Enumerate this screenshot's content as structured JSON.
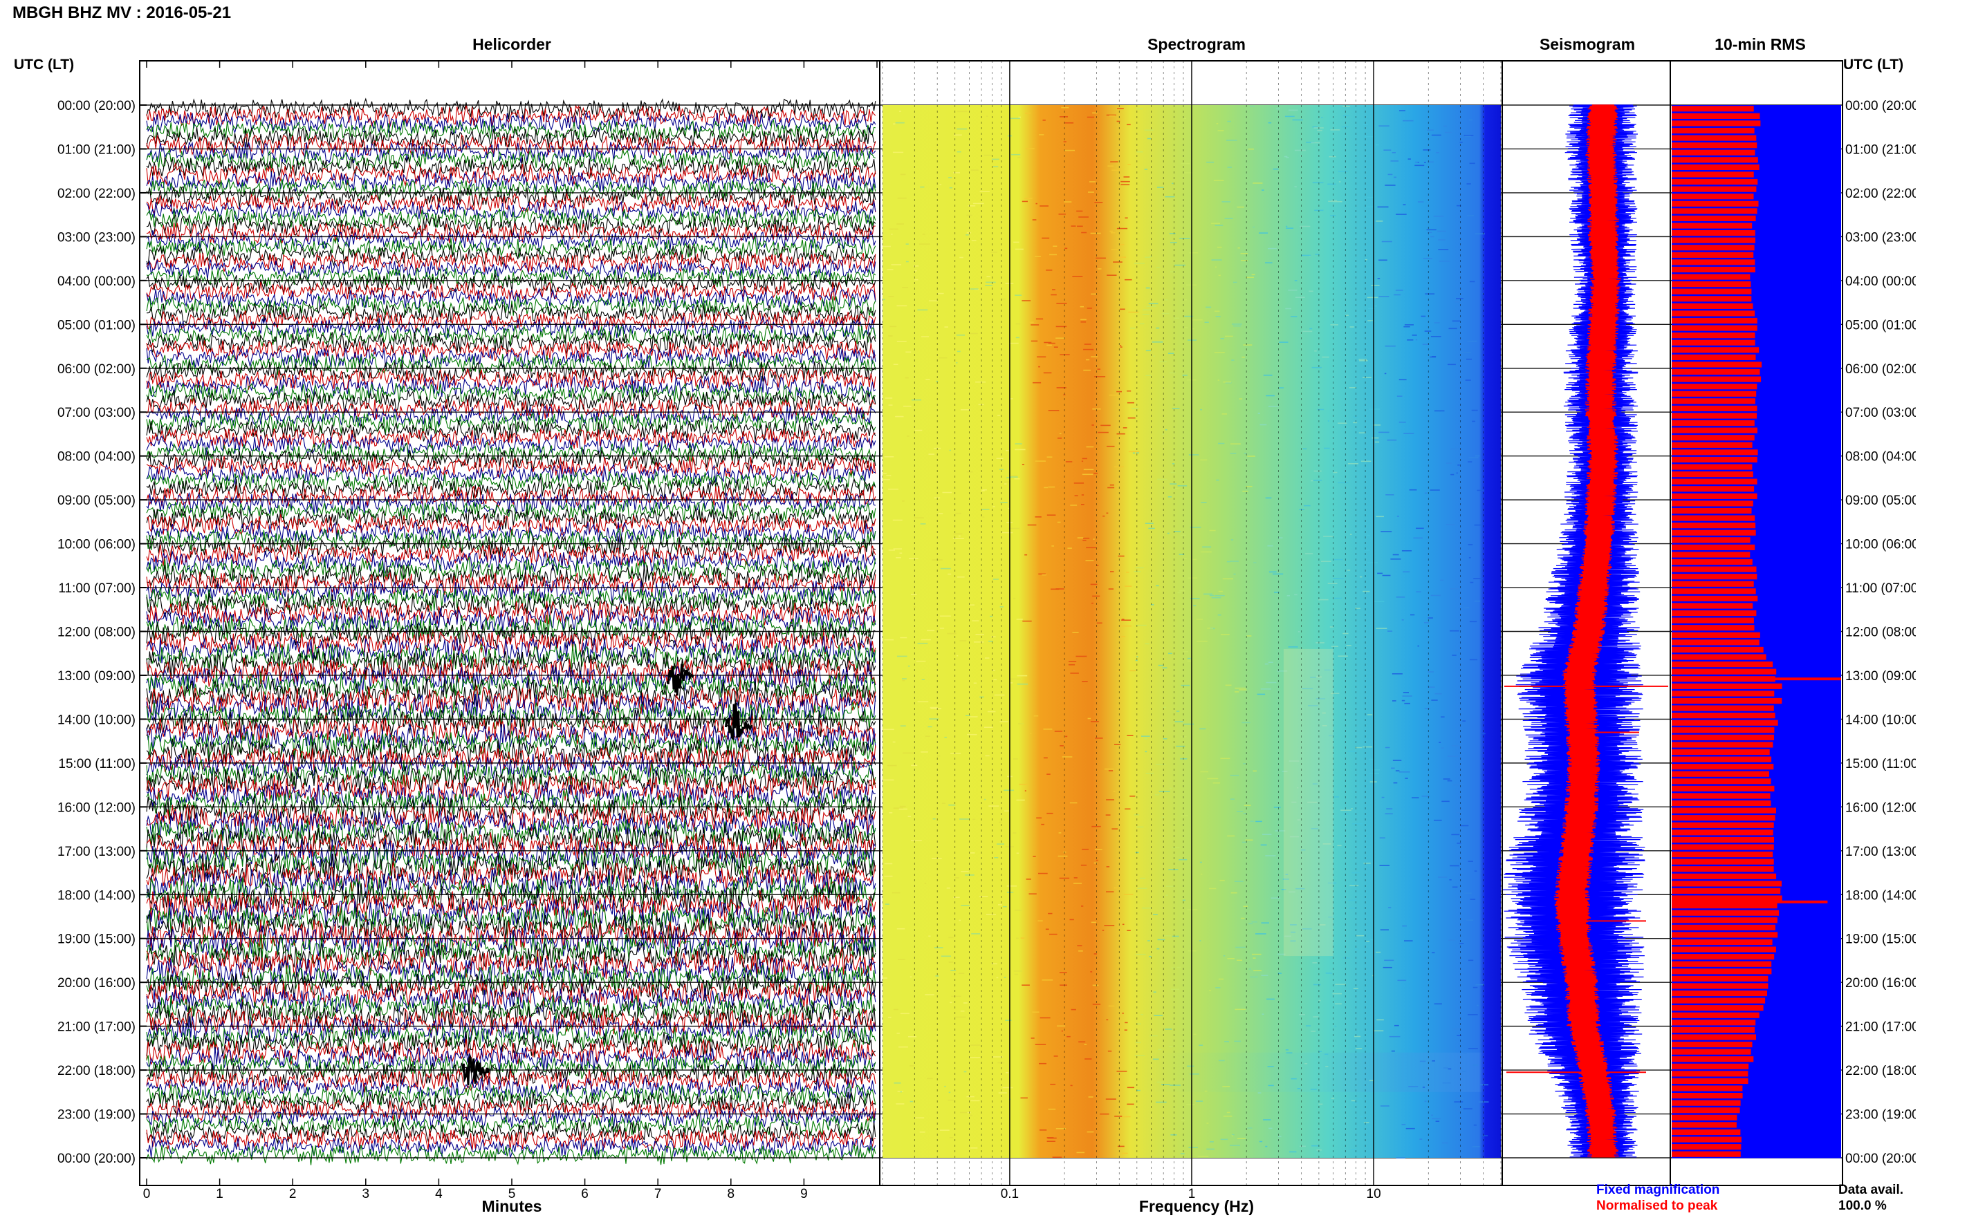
{
  "header": {
    "title": "MBGH BHZ MV : 2016-05-21"
  },
  "panels": {
    "helicorder": "Helicorder",
    "spectrogram": "Spectrogram",
    "seismogram": "Seismogram",
    "rms": "10-min RMS"
  },
  "axes": {
    "left_label": "UTC (LT)",
    "right_label": "UTC (LT)",
    "minutes_label": "Minutes",
    "frequency_label": "Frequency (Hz)"
  },
  "legend": {
    "fixed": "Fixed magnification",
    "normalised": "Normalised to peak",
    "avail_label": "Data avail.",
    "avail_value": "100.0 %"
  },
  "colors": {
    "trace_cycle": [
      "#000000",
      "#cc0000",
      "#00008b",
      "#007a00"
    ],
    "fixed": "#0000ff",
    "normalised": "#ff0000"
  },
  "chart_data": [
    {
      "type": "line",
      "title": "Helicorder",
      "xlabel": "Minutes",
      "xlim": [
        0,
        10
      ],
      "x_ticks": [
        "0",
        "1",
        "2",
        "3",
        "4",
        "5",
        "6",
        "7",
        "8",
        "9"
      ],
      "y_ticks_left": [
        "00:00 (20:00)",
        "01:00 (21:00)",
        "02:00 (22:00)",
        "03:00 (23:00)",
        "04:00 (00:00)",
        "05:00 (01:00)",
        "06:00 (02:00)",
        "07:00 (03:00)",
        "08:00 (04:00)",
        "09:00 (05:00)",
        "10:00 (06:00)",
        "11:00 (07:00)",
        "12:00 (08:00)",
        "13:00 (09:00)",
        "14:00 (10:00)",
        "15:00 (11:00)",
        "16:00 (12:00)",
        "17:00 (13:00)",
        "18:00 (14:00)",
        "19:00 (15:00)",
        "20:00 (16:00)",
        "21:00 (17:00)",
        "22:00 (18:00)",
        "23:00 (19:00)",
        "00:00 (20:00)"
      ],
      "rows_per_hour": 6,
      "events": [
        {
          "time": "13:00",
          "minute": 7.3,
          "label": ""
        },
        {
          "time": "14:10",
          "minute": 8.1,
          "label": ""
        },
        {
          "time": "22:00",
          "minute": 4.5,
          "label": ""
        }
      ]
    },
    {
      "type": "heatmap",
      "title": "Spectrogram",
      "xlabel": "Frequency (Hz)",
      "x_scale": "log",
      "xlim": [
        0.02,
        50
      ],
      "x_ticks": [
        "0.1",
        "1",
        "10"
      ],
      "peak_band_hz": [
        0.2,
        0.5
      ]
    },
    {
      "type": "area",
      "title": "Seismogram",
      "series": [
        {
          "name": "Fixed magnification",
          "values": [
            0.55,
            0.6,
            0.55,
            0.55,
            0.5,
            0.55,
            0.6,
            0.6,
            0.55,
            0.6,
            0.65,
            0.75,
            0.85,
            1.05,
            1.0,
            0.95,
            1.0,
            1.1,
            1.2,
            1.15,
            1.0,
            0.95,
            0.75,
            0.6,
            0.55
          ]
        }
      ]
    },
    {
      "type": "bar",
      "title": "10-min RMS",
      "categories": [
        "00:00",
        "01:00",
        "02:00",
        "03:00",
        "04:00",
        "05:00",
        "06:00",
        "07:00",
        "08:00",
        "09:00",
        "10:00",
        "11:00",
        "12:00",
        "13:00",
        "14:00",
        "15:00",
        "16:00",
        "17:00",
        "18:00",
        "19:00",
        "20:00",
        "21:00",
        "22:00",
        "23:00",
        "00:00"
      ],
      "values": [
        0.7,
        0.7,
        0.7,
        0.68,
        0.66,
        0.7,
        0.72,
        0.7,
        0.68,
        0.68,
        0.66,
        0.68,
        0.7,
        0.88,
        0.86,
        0.82,
        0.84,
        0.84,
        0.88,
        0.85,
        0.78,
        0.7,
        0.64,
        0.55,
        0.55
      ],
      "peak_marks": [
        {
          "time": "13:05",
          "value": 1.0
        },
        {
          "time": "18:10",
          "value": 0.92
        }
      ]
    }
  ]
}
